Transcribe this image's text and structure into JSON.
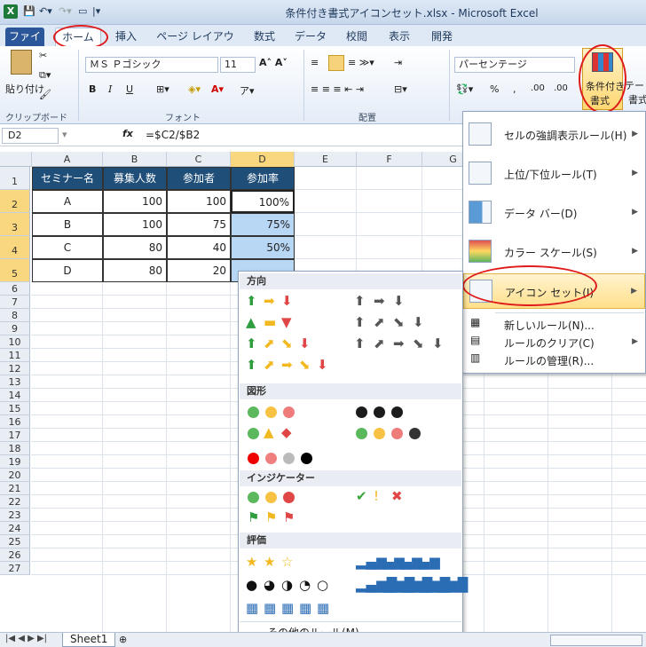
{
  "window": {
    "title": "条件付き書式アイコンセット.xlsx - Microsoft Excel",
    "app_icon": "X"
  },
  "tabs": [
    "ファイル",
    "ホーム",
    "挿入",
    "ページ レイアウト",
    "数式",
    "データ",
    "校閲",
    "表示",
    "開発"
  ],
  "ribbon": {
    "clipboard": {
      "paste": "貼り付け",
      "label": "クリップボード"
    },
    "font": {
      "name": "ＭＳ Ｐゴシック",
      "size": "11",
      "label": "フォント",
      "bold": "B",
      "italic": "I",
      "underline": "U"
    },
    "alignment": {
      "label": "配置"
    },
    "number": {
      "format": "パーセンテージ",
      "percent": "%",
      "comma": ",",
      "inc_dec": ".00",
      "dec_dec": ".00"
    },
    "cond_format": {
      "line1": "条件付き",
      "line2": "書式"
    },
    "table_format_partial": {
      "line1": "テー",
      "line2": "書式"
    }
  },
  "formula_bar": {
    "name_box": "D2",
    "fx": "fx",
    "formula": "=$C2/$B2"
  },
  "columns": [
    "A",
    "B",
    "C",
    "D",
    "E",
    "F",
    "G"
  ],
  "rows": [
    "1",
    "2",
    "3",
    "4",
    "5",
    "6",
    "7",
    "8",
    "9",
    "10",
    "11",
    "12",
    "13",
    "14",
    "15",
    "16",
    "17",
    "18",
    "19",
    "20",
    "21",
    "22",
    "23",
    "24",
    "25",
    "26",
    "27"
  ],
  "table": {
    "headers": [
      "セミナー名",
      "募集人数",
      "参加者",
      "参加率"
    ],
    "rows": [
      [
        "A",
        "100",
        "100",
        "100%"
      ],
      [
        "B",
        "100",
        "75",
        "75%"
      ],
      [
        "C",
        "80",
        "40",
        "50%"
      ],
      [
        "D",
        "80",
        "20",
        ""
      ]
    ]
  },
  "cf_menu": {
    "items": [
      {
        "label": "セルの強調表示ルール(H)",
        "icon": "highlight-rules-icon"
      },
      {
        "label": "上位/下位ルール(T)",
        "icon": "top-bottom-rules-icon"
      },
      {
        "label": "データ バー(D)",
        "icon": "data-bars-icon"
      },
      {
        "label": "カラー スケール(S)",
        "icon": "color-scales-icon"
      },
      {
        "label": "アイコン セット(I)",
        "icon": "icon-sets-icon"
      }
    ],
    "small_items": [
      {
        "label": "新しいルール(N)..."
      },
      {
        "label": "ルールのクリア(C)"
      },
      {
        "label": "ルールの管理(R)..."
      }
    ]
  },
  "icon_panel": {
    "sections": [
      "方向",
      "図形",
      "インジケーター",
      "評価"
    ],
    "more_rules": "その他のルール(M)..."
  },
  "sheet_tabs": {
    "active": "Sheet1"
  },
  "colors": {
    "header_fill": "#1f4e79",
    "selected_fill": "#b7d7f5",
    "annotation": "#e01b1b"
  }
}
